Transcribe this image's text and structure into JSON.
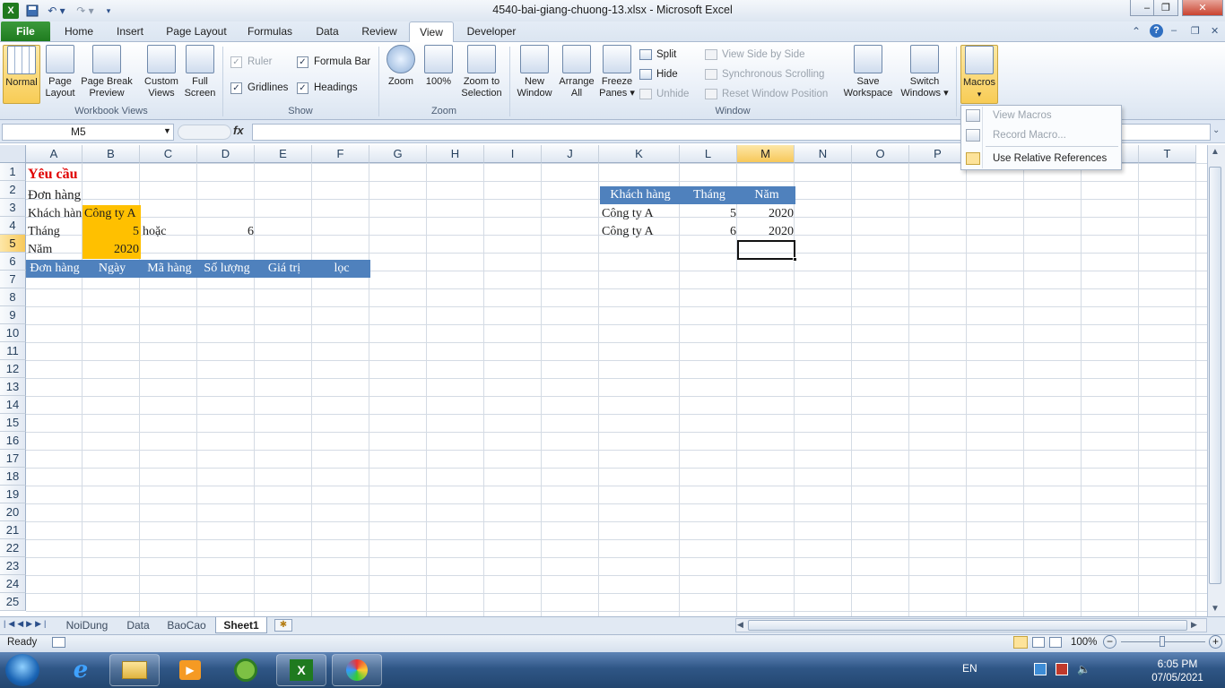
{
  "window": {
    "title": "4540-bai-giang-chuong-13.xlsx  -  Microsoft Excel",
    "minimize": "–",
    "restore": "❐",
    "close": "✕"
  },
  "qat": {
    "save_icon": "save-icon",
    "undo_icon": "undo-icon",
    "redo_icon": "redo-icon"
  },
  "tabs": [
    "File",
    "Home",
    "Insert",
    "Page Layout",
    "Formulas",
    "Data",
    "Review",
    "View",
    "Developer"
  ],
  "active_tab": "View",
  "ribbon": {
    "workbook_views": {
      "label": "Workbook Views",
      "normal": "Normal",
      "page_layout": [
        "Page",
        "Layout"
      ],
      "page_break": [
        "Page Break",
        "Preview"
      ],
      "custom_views": [
        "Custom",
        "Views"
      ],
      "full_screen": [
        "Full",
        "Screen"
      ]
    },
    "show": {
      "label": "Show",
      "ruler": "Ruler",
      "formula_bar": "Formula Bar",
      "gridlines": "Gridlines",
      "headings": "Headings"
    },
    "zoom": {
      "label": "Zoom",
      "zoom": "Zoom",
      "hundred": "100%",
      "zoom_sel": [
        "Zoom to",
        "Selection"
      ]
    },
    "window": {
      "label": "Window",
      "new_window": [
        "New",
        "Window"
      ],
      "arrange_all": [
        "Arrange",
        "All"
      ],
      "freeze": [
        "Freeze",
        "Panes ▾"
      ],
      "split": "Split",
      "hide": "Hide",
      "unhide": "Unhide",
      "side_by_side": "View Side by Side",
      "sync_scroll": "Synchronous Scrolling",
      "reset_pos": "Reset Window Position",
      "save_ws": [
        "Save",
        "Workspace"
      ],
      "switch": [
        "Switch",
        "Windows ▾"
      ]
    },
    "macros": {
      "label": "Macros",
      "arrow": "▾"
    }
  },
  "macros_menu": [
    "View Macros",
    "Record Macro...",
    "Use Relative References"
  ],
  "formula_bar": {
    "name_box": "M5",
    "fx": "fx",
    "formula": ""
  },
  "columns": [
    "A",
    "B",
    "C",
    "D",
    "E",
    "F",
    "G",
    "H",
    "I",
    "J",
    "K",
    "L",
    "M",
    "N",
    "O",
    "P",
    "Q",
    "R",
    "S",
    "T"
  ],
  "selected_column": "M",
  "rows": [
    "1",
    "2",
    "3",
    "4",
    "5",
    "6",
    "7",
    "8",
    "9",
    "10",
    "11",
    "12",
    "13",
    "14",
    "15",
    "16",
    "17",
    "18",
    "19",
    "20",
    "21",
    "22",
    "23",
    "24",
    "25"
  ],
  "selected_row": "5",
  "cells": {
    "A1": "Yêu cầu",
    "A2": "Đơn hàng",
    "A3": "Khách hàng",
    "B3": "Công ty A",
    "A4": "Tháng",
    "B4": "5",
    "C4": "hoặc",
    "D4": "6",
    "A5": "Năm",
    "B5": "2020",
    "header_row6": [
      "Đơn hàng",
      "Ngày",
      "Mã hàng",
      "Số lượng",
      "Giá trị",
      "lọc"
    ],
    "criteria_headers": [
      "Khách hàng",
      "Tháng",
      "Năm"
    ],
    "criteria_rows": [
      [
        "Công ty A",
        "5",
        "2020"
      ],
      [
        "Công ty A",
        "6",
        "2020"
      ]
    ]
  },
  "sheets": [
    "NoiDung",
    "Data",
    "BaoCao",
    "Sheet1"
  ],
  "active_sheet": "Sheet1",
  "status": {
    "ready": "Ready",
    "zoom": "100%"
  },
  "taskbar": {
    "lang": "EN",
    "time": "6:05 PM",
    "date": "07/05/2021"
  },
  "colors": {
    "orange": "#ffc000",
    "table_blue": "#4f81bd",
    "title_red": "#e00000"
  }
}
